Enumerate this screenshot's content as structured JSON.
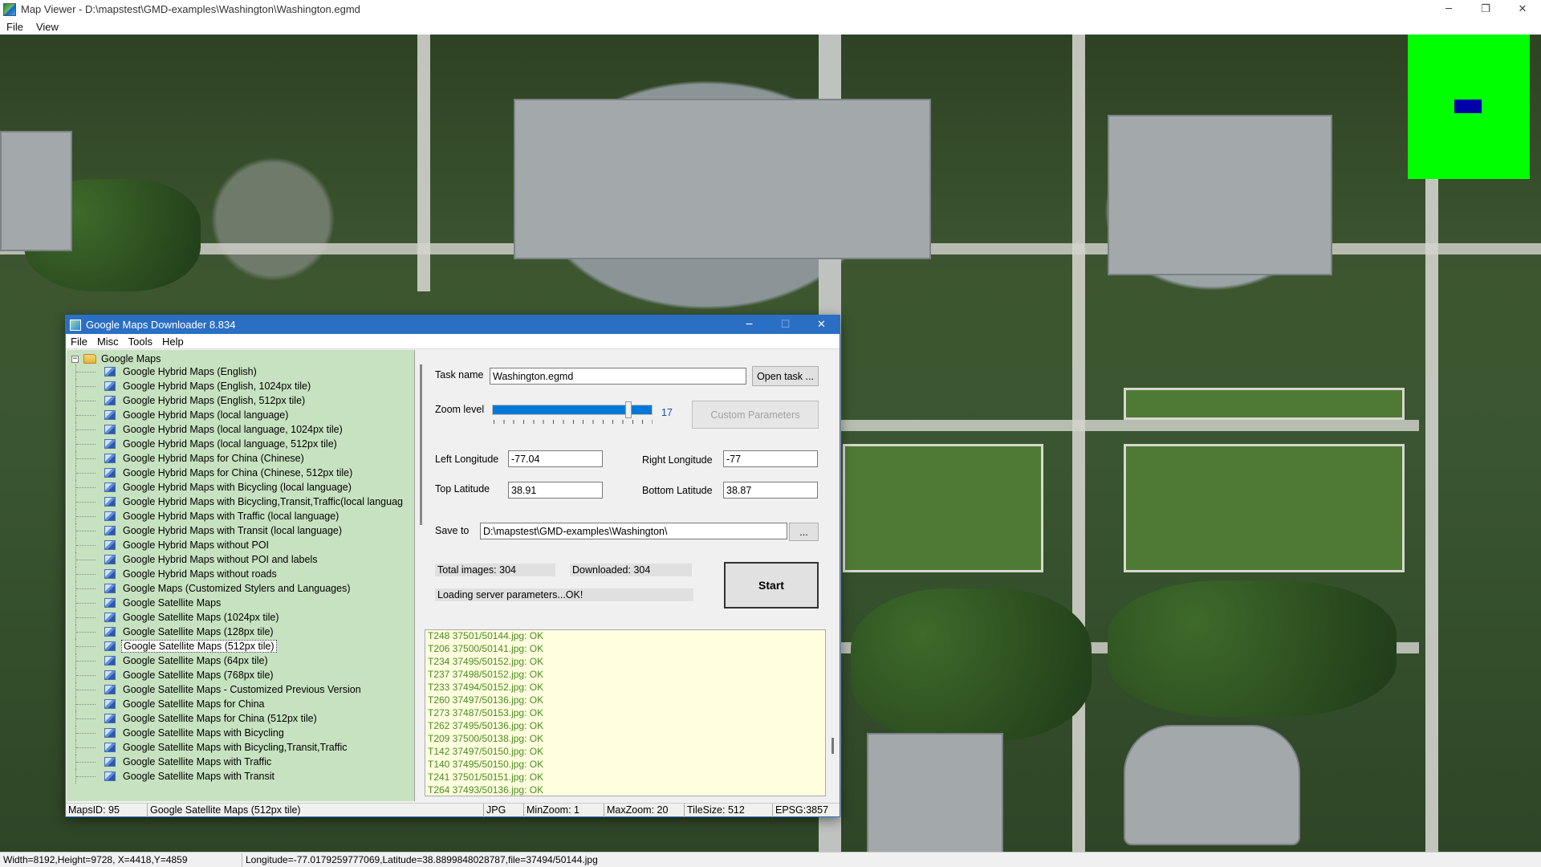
{
  "viewer": {
    "title": "Map Viewer - D:\\mapstest\\GMD-examples\\Washington\\Washington.egmd",
    "menu": [
      "File",
      "View"
    ],
    "window_controls": {
      "minimize": "─",
      "restore": "❐",
      "close": "✕"
    },
    "status": {
      "left": "Width=8192,Height=9728, X=4418,Y=4859",
      "right": "Longitude=-77.0179259777069,Latitude=38.8899848028787,file=37494/50144.jpg"
    },
    "colors": {
      "overview_bg": "#00ff00",
      "overview_viewport": "#0000aa"
    }
  },
  "gmd": {
    "title": "Google Maps Downloader 8.834",
    "window_controls": {
      "minimize": "─",
      "maximize": "☐",
      "close": "✕"
    },
    "menu": [
      "File",
      "Misc",
      "Tools",
      "Help"
    ],
    "tree": {
      "root_expander": "−",
      "root_label": "Google Maps",
      "items": [
        "Google Hybrid Maps (English)",
        "Google Hybrid Maps (English, 1024px tile)",
        "Google Hybrid Maps (English, 512px tile)",
        "Google Hybrid Maps (local language)",
        "Google Hybrid Maps (local language, 1024px tile)",
        "Google Hybrid Maps (local language, 512px tile)",
        "Google Hybrid Maps for China (Chinese)",
        "Google Hybrid Maps for China (Chinese, 512px tile)",
        "Google Hybrid Maps with Bicycling (local language)",
        "Google Hybrid Maps with Bicycling,Transit,Traffic(local languag",
        "Google Hybrid Maps with Traffic (local language)",
        "Google Hybrid Maps with Transit (local language)",
        "Google Hybrid Maps without POI",
        "Google Hybrid Maps without POI and labels",
        "Google Hybrid Maps without roads",
        "Google Maps (Customized Stylers and Languages)",
        "Google Satellite Maps",
        "Google Satellite Maps (1024px tile)",
        "Google Satellite Maps (128px tile)",
        "Google Satellite Maps (512px tile)",
        "Google Satellite Maps (64px tile)",
        "Google Satellite Maps (768px tile)",
        "Google Satellite Maps - Customized Previous Version",
        "Google Satellite Maps for China",
        "Google Satellite Maps for China (512px tile)",
        "Google Satellite Maps with Bicycling",
        "Google Satellite Maps with Bicycling,Transit,Traffic",
        "Google Satellite Maps with Traffic",
        "Google Satellite Maps with Transit"
      ],
      "selected": "Google Satellite Maps (512px tile)"
    },
    "form": {
      "task_name_label": "Task name",
      "task_name_value": "Washington.egmd",
      "open_task_label": "Open task ...",
      "zoom_label": "Zoom level",
      "zoom_value": "17",
      "zoom_fraction": 0.85,
      "custom_params_label": "Custom Parameters",
      "left_lon_label": "Left Longitude",
      "left_lon_value": "-77.04",
      "right_lon_label": "Right Longitude",
      "right_lon_value": "-77",
      "top_lat_label": "Top Latitude",
      "top_lat_value": "38.91",
      "bottom_lat_label": "Bottom Latitude",
      "bottom_lat_value": "38.87",
      "save_to_label": "Save to",
      "save_to_value": "D:\\mapstest\\GMD-examples\\Washington\\",
      "browse_label": "...",
      "total_images": "Total images: 304",
      "downloaded": "Downloaded: 304",
      "progress_text": "Loading server parameters...OK!",
      "start_label": "Start"
    },
    "log": [
      "T248 37501/50144.jpg: OK",
      "T206 37500/50141.jpg: OK",
      "T234 37495/50152.jpg: OK",
      "T237 37498/50152.jpg: OK",
      "T233 37494/50152.jpg: OK",
      "T260 37497/50136.jpg: OK",
      "T273 37487/50153.jpg: OK",
      "T262 37495/50136.jpg: OK",
      "T209 37500/50138.jpg: OK",
      "T142 37497/50150.jpg: OK",
      "T140 37495/50150.jpg: OK",
      "T241 37501/50151.jpg: OK",
      "T264 37493/50136.jpg: OK"
    ],
    "status": {
      "maps_id": "MapsID: 95",
      "map_name": "Google Satellite Maps (512px tile)",
      "format": "JPG",
      "min_zoom": "MinZoom: 1",
      "max_zoom": "MaxZoom: 20",
      "tile_size": "TileSize: 512",
      "epsg": "EPSG:3857"
    }
  }
}
